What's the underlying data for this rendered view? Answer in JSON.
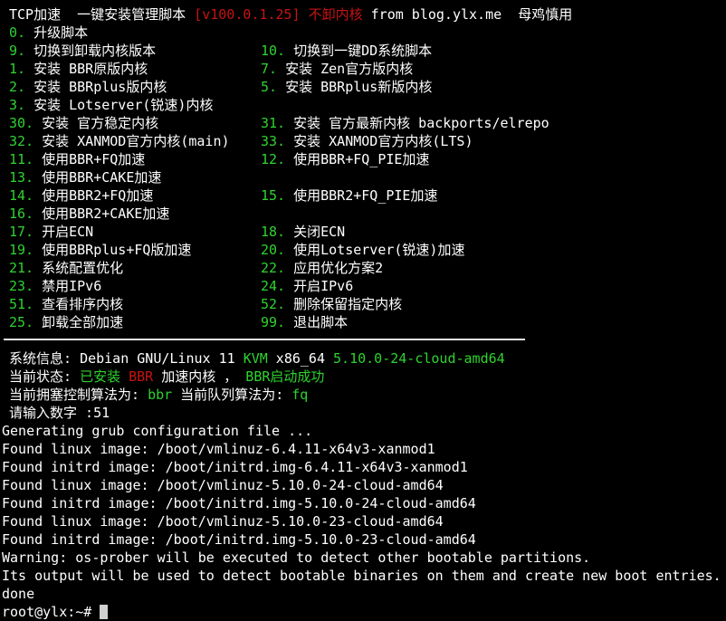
{
  "terminal": {
    "background": "#000000",
    "foreground": "#ffffff",
    "green": "#2fd32f",
    "red": "#c81212",
    "cursor_color": "#d0d0d0"
  },
  "header": {
    "title_part1": "TCP加速  一键安装管理脚本 ",
    "version": "[v100.0.1.25]",
    "title_red2": " 不卸内核",
    "title_part3": " from blog.ylx.me  母鸡慎用"
  },
  "menu": {
    "rows": [
      {
        "left": {
          "num": "0.",
          "label": " 升级脚本"
        },
        "right": null
      },
      {
        "left": {
          "num": "9.",
          "label": " 切换到卸载内核版本"
        },
        "right": {
          "num": "10.",
          "label": " 切换到一键DD系统脚本"
        }
      },
      {
        "left": {
          "num": "1.",
          "label": " 安装 BBR原版内核"
        },
        "right": {
          "num": "7.",
          "label": " 安装 Zen官方版内核"
        }
      },
      {
        "left": {
          "num": "2.",
          "label": " 安装 BBRplus版内核"
        },
        "right": {
          "num": "5.",
          "label": " 安装 BBRplus新版内核"
        }
      },
      {
        "left": {
          "num": "3.",
          "label": " 安装 Lotserver(锐速)内核"
        },
        "right": null
      },
      {
        "left": {
          "num": "30.",
          "label": " 安装 官方稳定内核"
        },
        "right": {
          "num": "31.",
          "label": " 安装 官方最新内核 backports/elrepo"
        }
      },
      {
        "left": {
          "num": "32.",
          "label": " 安装 XANMOD官方内核(main)"
        },
        "right": {
          "num": "33.",
          "label": " 安装 XANMOD官方内核(LTS)"
        }
      },
      {
        "left": {
          "num": "11.",
          "label": " 使用BBR+FQ加速"
        },
        "right": {
          "num": "12.",
          "label": " 使用BBR+FQ_PIE加速"
        }
      },
      {
        "left": {
          "num": "13.",
          "label": " 使用BBR+CAKE加速"
        },
        "right": null
      },
      {
        "left": {
          "num": "14.",
          "label": " 使用BBR2+FQ加速"
        },
        "right": {
          "num": "15.",
          "label": " 使用BBR2+FQ_PIE加速"
        }
      },
      {
        "left": {
          "num": "16.",
          "label": " 使用BBR2+CAKE加速"
        },
        "right": null
      },
      {
        "left": {
          "num": "17.",
          "label": " 开启ECN"
        },
        "right": {
          "num": "18.",
          "label": " 关闭ECN"
        }
      },
      {
        "left": {
          "num": "19.",
          "label": " 使用BBRplus+FQ版加速"
        },
        "right": {
          "num": "20.",
          "label": " 使用Lotserver(锐速)加速"
        }
      },
      {
        "left": {
          "num": "21.",
          "label": " 系统配置优化"
        },
        "right": {
          "num": "22.",
          "label": " 应用优化方案2"
        }
      },
      {
        "left": {
          "num": "23.",
          "label": " 禁用IPv6"
        },
        "right": {
          "num": "24.",
          "label": " 开启IPv6"
        }
      },
      {
        "left": {
          "num": "51.",
          "label": " 查看排序内核"
        },
        "right": {
          "num": "52.",
          "label": " 删除保留指定内核"
        }
      },
      {
        "left": {
          "num": "25.",
          "label": " 卸载全部加速"
        },
        "right": {
          "num": "99.",
          "label": " 退出脚本"
        }
      }
    ]
  },
  "status": {
    "sysinfo_label": "系统信息: ",
    "sysinfo_os": "Debian GNU/Linux 11 ",
    "sysinfo_virt": "KVM",
    "sysinfo_arch": " x86_64 ",
    "sysinfo_kernel": "5.10.0-24-cloud-amd64",
    "state_label": "当前状态: ",
    "state_installed": "已安装",
    "state_algo": " BBR ",
    "state_mid": "加速内核 ， ",
    "state_started": "BBR启动成功",
    "cc_label": "当前拥塞控制算法为: ",
    "cc_value": "bbr",
    "qdisc_label": " 当前队列算法为: ",
    "qdisc_value": "fq",
    "prompt_label": "请输入数字 :",
    "prompt_value": "51"
  },
  "output": {
    "lines": [
      "Generating grub configuration file ...",
      "Found linux image: /boot/vmlinuz-6.4.11-x64v3-xanmod1",
      "Found initrd image: /boot/initrd.img-6.4.11-x64v3-xanmod1",
      "Found linux image: /boot/vmlinuz-5.10.0-24-cloud-amd64",
      "Found initrd image: /boot/initrd.img-5.10.0-24-cloud-amd64",
      "Found linux image: /boot/vmlinuz-5.10.0-23-cloud-amd64",
      "Found initrd image: /boot/initrd.img-5.10.0-23-cloud-amd64",
      "Warning: os-prober will be executed to detect other bootable partitions.",
      "Its output will be used to detect bootable binaries on them and create new boot entries.",
      "done"
    ]
  },
  "shell": {
    "prompt": "root@ylx:~# "
  }
}
